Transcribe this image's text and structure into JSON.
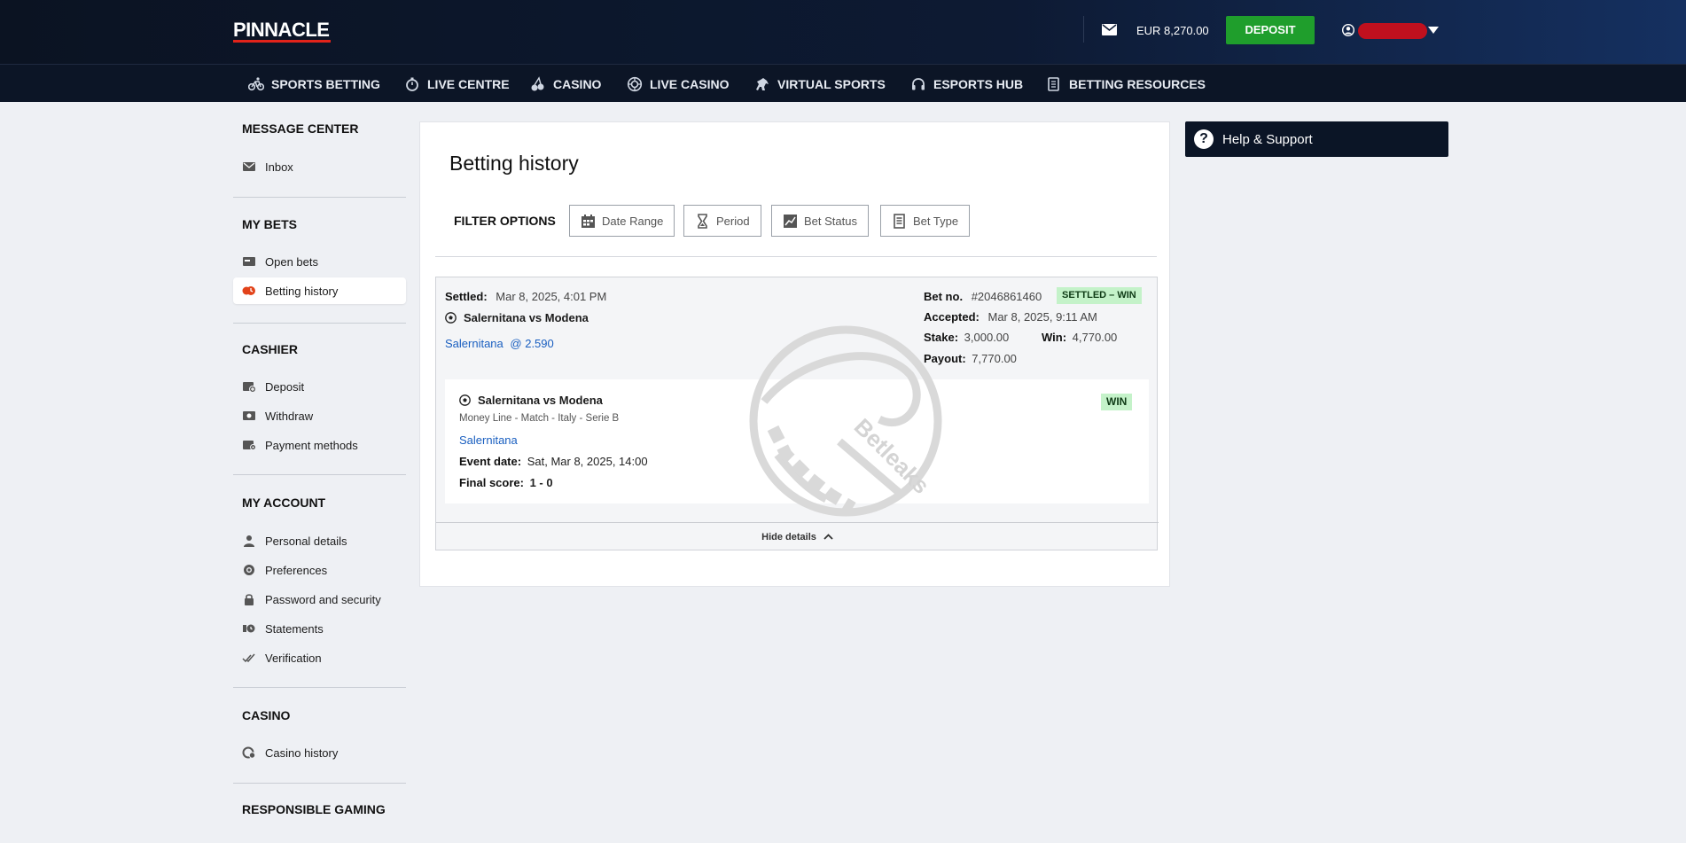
{
  "header": {
    "logo_text": "PINNACLE",
    "balance": "EUR 8,270.00",
    "deposit_label": "DEPOSIT"
  },
  "nav": [
    {
      "label": "SPORTS BETTING",
      "icon": "bicycle-icon"
    },
    {
      "label": "LIVE CENTRE",
      "icon": "stopwatch-icon"
    },
    {
      "label": "CASINO",
      "icon": "cherries-icon"
    },
    {
      "label": "LIVE CASINO",
      "icon": "roulette-icon"
    },
    {
      "label": "VIRTUAL SPORTS",
      "icon": "horse-icon"
    },
    {
      "label": "ESPORTS HUB",
      "icon": "headset-icon"
    },
    {
      "label": "BETTING RESOURCES",
      "icon": "book-icon"
    }
  ],
  "sidebar": {
    "message_center": {
      "title": "MESSAGE CENTER",
      "items": [
        "Inbox"
      ]
    },
    "my_bets": {
      "title": "MY BETS",
      "items": [
        "Open bets",
        "Betting history"
      ]
    },
    "cashier": {
      "title": "CASHIER",
      "items": [
        "Deposit",
        "Withdraw",
        "Payment methods"
      ]
    },
    "my_account": {
      "title": "MY ACCOUNT",
      "items": [
        "Personal details",
        "Preferences",
        "Password and security",
        "Statements",
        "Verification"
      ]
    },
    "casino": {
      "title": "CASINO",
      "items": [
        "Casino history"
      ]
    },
    "responsible": {
      "title": "RESPONSIBLE GAMING"
    }
  },
  "main": {
    "title": "Betting history",
    "filter_label": "FILTER OPTIONS",
    "filters": [
      "Date Range",
      "Period",
      "Bet Status",
      "Bet Type"
    ]
  },
  "bet": {
    "settled_label": "Settled:",
    "settled_value": "Mar 8, 2025, 4:01 PM",
    "match": "Salernitana vs Modena",
    "selection": "Salernitana",
    "odds": "@ 2.590",
    "bet_no_label": "Bet no.",
    "bet_no_value": "#2046861460",
    "status": "SETTLED – WIN",
    "accepted_label": "Accepted:",
    "accepted_value": "Mar 8, 2025, 9:11 AM",
    "stake_label": "Stake:",
    "stake_value": "3,000.00",
    "win_label": "Win:",
    "win_value": "4,770.00",
    "payout_label": "Payout:",
    "payout_value": "7,770.00",
    "leg": {
      "match": "Salernitana vs Modena",
      "market": "Money Line - Match - Italy - Serie B",
      "selection": "Salernitana",
      "event_label": "Event date:",
      "event_value": "Sat, Mar 8, 2025, 14:00",
      "score_label": "Final score:",
      "score_value": "1 - 0",
      "result": "WIN"
    },
    "hide_details": "Hide details",
    "watermark_text": "Betleaks"
  },
  "help": {
    "label": "Help & Support"
  }
}
